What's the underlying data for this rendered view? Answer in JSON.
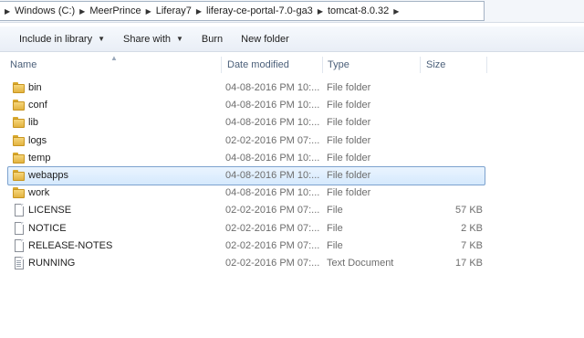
{
  "breadcrumb": [
    "Windows (C:)",
    "MeerPrince",
    "Liferay7",
    "liferay-ce-portal-7.0-ga3",
    "tomcat-8.0.32"
  ],
  "toolbar": {
    "include_library": "Include in library",
    "share_with": "Share with",
    "burn": "Burn",
    "new_folder": "New folder"
  },
  "columns": {
    "name": "Name",
    "date_modified": "Date modified",
    "type": "Type",
    "size": "Size"
  },
  "rows": [
    {
      "name": "bin",
      "date": "04-08-2016 PM 10:...",
      "type": "File folder",
      "size": "",
      "icon": "folder-icon"
    },
    {
      "name": "conf",
      "date": "04-08-2016 PM 10:...",
      "type": "File folder",
      "size": "",
      "icon": "folder-icon"
    },
    {
      "name": "lib",
      "date": "04-08-2016 PM 10:...",
      "type": "File folder",
      "size": "",
      "icon": "folder-icon"
    },
    {
      "name": "logs",
      "date": "02-02-2016 PM 07:...",
      "type": "File folder",
      "size": "",
      "icon": "folder-icon"
    },
    {
      "name": "temp",
      "date": "04-08-2016 PM 10:...",
      "type": "File folder",
      "size": "",
      "icon": "folder-icon"
    },
    {
      "name": "webapps",
      "date": "04-08-2016 PM 10:...",
      "type": "File folder",
      "size": "",
      "icon": "folder-icon",
      "selected": true
    },
    {
      "name": "work",
      "date": "04-08-2016 PM 10:...",
      "type": "File folder",
      "size": "",
      "icon": "folder-icon"
    },
    {
      "name": "LICENSE",
      "date": "02-02-2016 PM 07:...",
      "type": "File",
      "size": "57 KB",
      "icon": "file-icon"
    },
    {
      "name": "NOTICE",
      "date": "02-02-2016 PM 07:...",
      "type": "File",
      "size": "2 KB",
      "icon": "file-icon"
    },
    {
      "name": "RELEASE-NOTES",
      "date": "02-02-2016 PM 07:...",
      "type": "File",
      "size": "7 KB",
      "icon": "file-icon"
    },
    {
      "name": "RUNNING",
      "date": "02-02-2016 PM 07:...",
      "type": "Text Document",
      "size": "17 KB",
      "icon": "text-document-icon"
    }
  ],
  "colors": {
    "selection_bg": "#d5e9fd",
    "selection_border": "#7da2ce",
    "header_text": "#4c607a"
  }
}
